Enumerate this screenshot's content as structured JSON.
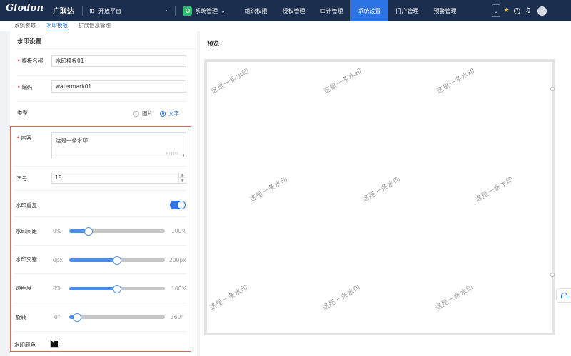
{
  "topbar": {
    "logo_text": "Glodon",
    "logo_cn": "广联达",
    "platform_label": "开放平台",
    "system_menu_label": "系统管理",
    "nav_tabs": [
      {
        "label": "组织权限",
        "active": false
      },
      {
        "label": "授权管理",
        "active": false
      },
      {
        "label": "审计管理",
        "active": false
      },
      {
        "label": "系统设置",
        "active": true
      },
      {
        "label": "门户管理",
        "active": false
      },
      {
        "label": "预警管理",
        "active": false
      }
    ],
    "icons": [
      "collapse-icon",
      "star-icon",
      "help-icon",
      "bell-icon"
    ],
    "accent_color": "#2d74e6",
    "bar_color": "#1b2e4d"
  },
  "subtabs": [
    {
      "label": "系统参数",
      "active": false
    },
    {
      "label": "水印模板",
      "active": true
    },
    {
      "label": "扩展信息管理",
      "active": false
    }
  ],
  "form": {
    "section_title": "水印设置",
    "template_name": {
      "label": "模板名称",
      "value": "水印模板01",
      "required": true
    },
    "code": {
      "label": "编码",
      "value": "watermark01",
      "required": true
    },
    "type": {
      "label": "类型",
      "options": [
        "图片",
        "文字"
      ],
      "selected": "文字"
    },
    "content": {
      "label": "内容",
      "value": "这是一条水印",
      "counter": "6/100",
      "required": true
    },
    "font_size": {
      "label": "字号",
      "value": "18"
    },
    "repeat": {
      "label": "水印重复",
      "on": true
    },
    "spacing": {
      "label": "水印间距",
      "min": "0%",
      "max": "100%",
      "level": 0.2
    },
    "stagger": {
      "label": "水印交错",
      "min": "0px",
      "max": "200px",
      "level": 0.5
    },
    "opacity": {
      "label": "透明度",
      "min": "0%",
      "max": "100%",
      "level": 0.5
    },
    "rotation": {
      "label": "旋转",
      "min": "0°",
      "max": "360°",
      "level": 0.08
    },
    "color": {
      "label": "水印颜色",
      "value": "#111111"
    }
  },
  "preview": {
    "title": "预览",
    "watermark_text": "这是一条水印"
  }
}
